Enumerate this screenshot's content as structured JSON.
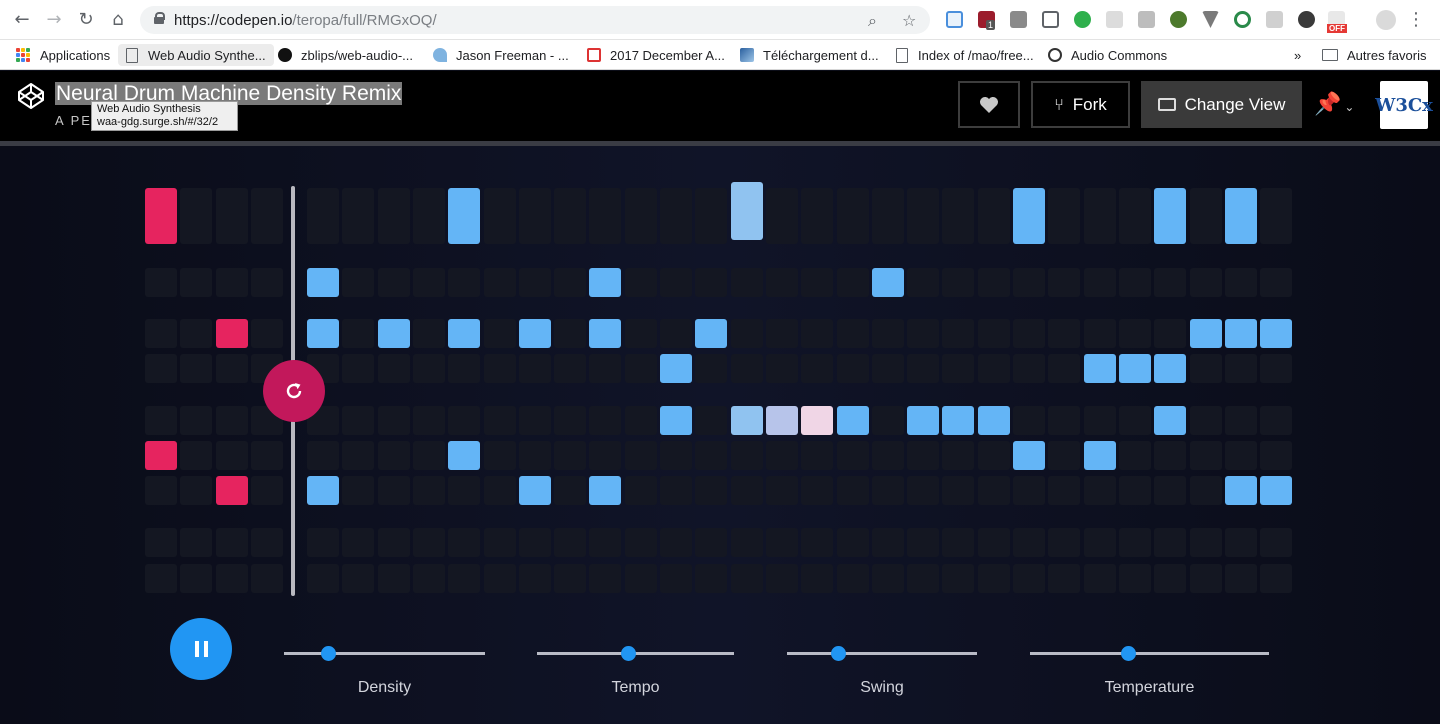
{
  "browser": {
    "url_host": "https://codepen.io",
    "url_path": "/teropa/full/RMGxOQ/",
    "bookmarks": [
      {
        "label": "Applications"
      },
      {
        "label": "Web Audio Synthe..."
      },
      {
        "label": "zblips/web-audio-..."
      },
      {
        "label": "Jason Freeman - ..."
      },
      {
        "label": "2017 December A..."
      },
      {
        "label": "Téléchargement d..."
      },
      {
        "label": "Index of /mao/free..."
      },
      {
        "label": "Audio Commons"
      }
    ],
    "more_bookmarks": "»",
    "other_bookmarks": "Autres favoris",
    "ext_badge_count": "1",
    "ext_off_label": "OFF"
  },
  "header": {
    "title": "Neural Drum Machine Density Remix",
    "subtitle": "A PEN",
    "tooltip_title": "Web Audio Synthesis",
    "tooltip_url": "waa-gdg.surge.sh/#/32/2",
    "fork_label": "Fork",
    "change_view_label": "Change View",
    "avatar_text": "W3Cx"
  },
  "controls": {
    "sliders": [
      {
        "label": "Density",
        "value": 0.22
      },
      {
        "label": "Tempo",
        "value": 0.46
      },
      {
        "label": "Swing",
        "value": 0.27
      },
      {
        "label": "Temperature",
        "value": 0.41
      }
    ]
  },
  "sequencer": {
    "seed_steps": 4,
    "generated_steps": 28,
    "rows": 9,
    "seed_active": [
      {
        "row": 0,
        "step": 0
      },
      {
        "row": 2,
        "step": 2
      },
      {
        "row": 5,
        "step": 0
      },
      {
        "row": 6,
        "step": 2
      }
    ],
    "generated_active": [
      {
        "row": 0,
        "step": 4,
        "style": "blue"
      },
      {
        "row": 0,
        "step": 12,
        "style": "ghost"
      },
      {
        "row": 0,
        "step": 20,
        "style": "blue"
      },
      {
        "row": 0,
        "step": 24,
        "style": "blue"
      },
      {
        "row": 0,
        "step": 26,
        "style": "blue"
      },
      {
        "row": 1,
        "step": 0,
        "style": "blue"
      },
      {
        "row": 1,
        "step": 8,
        "style": "blue"
      },
      {
        "row": 1,
        "step": 16,
        "style": "blue"
      },
      {
        "row": 2,
        "step": 0,
        "style": "blue"
      },
      {
        "row": 2,
        "step": 2,
        "style": "blue"
      },
      {
        "row": 2,
        "step": 4,
        "style": "blue"
      },
      {
        "row": 2,
        "step": 6,
        "style": "blue"
      },
      {
        "row": 2,
        "step": 8,
        "style": "blue"
      },
      {
        "row": 2,
        "step": 11,
        "style": "blue"
      },
      {
        "row": 2,
        "step": 25,
        "style": "blue"
      },
      {
        "row": 2,
        "step": 26,
        "style": "blue"
      },
      {
        "row": 2,
        "step": 27,
        "style": "blue"
      },
      {
        "row": 3,
        "step": 10,
        "style": "blue"
      },
      {
        "row": 3,
        "step": 22,
        "style": "blue"
      },
      {
        "row": 3,
        "step": 23,
        "style": "blue"
      },
      {
        "row": 3,
        "step": 24,
        "style": "blue"
      },
      {
        "row": 4,
        "step": 10,
        "style": "blue"
      },
      {
        "row": 4,
        "step": 12,
        "style": "ghost"
      },
      {
        "row": 4,
        "step": 13,
        "style": "lav"
      },
      {
        "row": 4,
        "step": 14,
        "style": "rose"
      },
      {
        "row": 4,
        "step": 15,
        "style": "blue"
      },
      {
        "row": 4,
        "step": 17,
        "style": "blue"
      },
      {
        "row": 4,
        "step": 18,
        "style": "blue"
      },
      {
        "row": 4,
        "step": 19,
        "style": "blue"
      },
      {
        "row": 4,
        "step": 24,
        "style": "blue"
      },
      {
        "row": 5,
        "step": 4,
        "style": "blue"
      },
      {
        "row": 5,
        "step": 20,
        "style": "blue"
      },
      {
        "row": 5,
        "step": 22,
        "style": "blue"
      },
      {
        "row": 6,
        "step": 0,
        "style": "blue"
      },
      {
        "row": 6,
        "step": 6,
        "style": "blue"
      },
      {
        "row": 6,
        "step": 8,
        "style": "blue"
      },
      {
        "row": 6,
        "step": 26,
        "style": "blue"
      },
      {
        "row": 6,
        "step": 27,
        "style": "blue"
      }
    ]
  }
}
